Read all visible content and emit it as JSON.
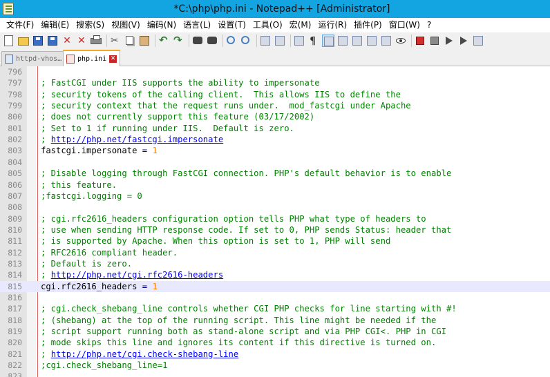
{
  "window": {
    "title": "*C:\\php\\php.ini - Notepad++ [Administrator]"
  },
  "menu": [
    "文件(F)",
    "编辑(E)",
    "搜索(S)",
    "视图(V)",
    "编码(N)",
    "语言(L)",
    "设置(T)",
    "工具(O)",
    "宏(M)",
    "运行(R)",
    "插件(P)",
    "窗口(W)",
    "?"
  ],
  "tabs": [
    {
      "label": "httpd-vhos…",
      "active": false
    },
    {
      "label": "php.ini",
      "active": true
    }
  ],
  "toolbar": {
    "icons": [
      "new-file-icon",
      "open-file-icon",
      "save-icon",
      "save-all-icon",
      "close-icon",
      "close-all-icon",
      "print-icon",
      "cut-icon",
      "copy-icon",
      "paste-icon",
      "undo-icon",
      "redo-icon",
      "find-icon",
      "replace-icon",
      "zoom-in-icon",
      "zoom-out-icon",
      "sync-v-icon",
      "sync-h-icon",
      "word-wrap-icon",
      "show-all-chars-icon",
      "indent-guide-icon",
      "udl-icon",
      "doc-map-icon",
      "function-list-icon",
      "folder-workspace-icon",
      "monitor-icon",
      "record-macro-icon",
      "stop-macro-icon",
      "play-macro-icon",
      "run-macro-icon",
      "save-macro-icon"
    ]
  },
  "editor": {
    "current_line": "815",
    "lines": [
      {
        "n": "796",
        "type": "blank",
        "text": ""
      },
      {
        "n": "797",
        "type": "comment",
        "text": "; FastCGI under IIS supports the ability to impersonate"
      },
      {
        "n": "798",
        "type": "comment",
        "text": "; security tokens of the calling client.  This allows IIS to define the"
      },
      {
        "n": "799",
        "type": "comment",
        "text": "; security context that the request runs under.  mod_fastcgi under Apache"
      },
      {
        "n": "800",
        "type": "comment",
        "text": "; does not currently support this feature (03/17/2002)"
      },
      {
        "n": "801",
        "type": "comment",
        "text": "; Set to 1 if running under IIS.  Default is zero."
      },
      {
        "n": "802",
        "type": "comment-url",
        "prefix": "; ",
        "url": "http://php.net/fastcgi.impersonate"
      },
      {
        "n": "803",
        "type": "setting",
        "key": "fastcgi.impersonate",
        "op": " = ",
        "value": "1"
      },
      {
        "n": "804",
        "type": "blank",
        "text": ""
      },
      {
        "n": "805",
        "type": "comment",
        "text": "; Disable logging through FastCGI connection. PHP's default behavior is to enable"
      },
      {
        "n": "806",
        "type": "comment",
        "text": "; this feature."
      },
      {
        "n": "807",
        "type": "comment",
        "text": ";fastcgi.logging = 0"
      },
      {
        "n": "808",
        "type": "blank",
        "text": ""
      },
      {
        "n": "809",
        "type": "comment",
        "text": "; cgi.rfc2616_headers configuration option tells PHP what type of headers to"
      },
      {
        "n": "810",
        "type": "comment",
        "text": "; use when sending HTTP response code. If set to 0, PHP sends Status: header that"
      },
      {
        "n": "811",
        "type": "comment",
        "text": "; is supported by Apache. When this option is set to 1, PHP will send"
      },
      {
        "n": "812",
        "type": "comment",
        "text": "; RFC2616 compliant header."
      },
      {
        "n": "813",
        "type": "comment",
        "text": "; Default is zero."
      },
      {
        "n": "814",
        "type": "comment-url",
        "prefix": "; ",
        "url": "http://php.net/cgi.rfc2616-headers"
      },
      {
        "n": "815",
        "type": "setting",
        "key": "cgi.rfc2616_headers",
        "op": " = ",
        "value": "1"
      },
      {
        "n": "816",
        "type": "blank",
        "text": ""
      },
      {
        "n": "817",
        "type": "comment",
        "text": "; cgi.check_shebang_line controls whether CGI PHP checks for line starting with #!"
      },
      {
        "n": "818",
        "type": "comment",
        "text": "; (shebang) at the top of the running script. This line might be needed if the"
      },
      {
        "n": "819",
        "type": "comment",
        "text": "; script support running both as stand-alone script and via PHP CGI<. PHP in CGI"
      },
      {
        "n": "820",
        "type": "comment",
        "text": "; mode skips this line and ignores its content if this directive is turned on."
      },
      {
        "n": "821",
        "type": "comment-url",
        "prefix": "; ",
        "url": "http://php.net/cgi.check-shebang-line"
      },
      {
        "n": "822",
        "type": "comment",
        "text": ";cgi.check_shebang_line=1"
      },
      {
        "n": "823",
        "type": "blank",
        "text": ""
      }
    ]
  }
}
